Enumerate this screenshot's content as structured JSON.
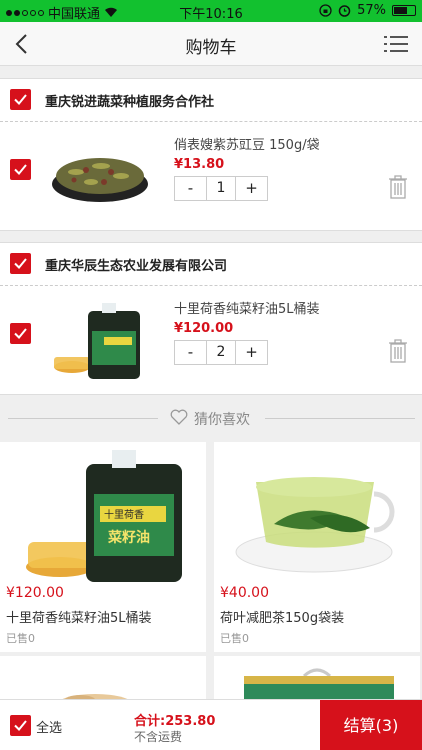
{
  "status_bar": {
    "carrier": "中国联通",
    "time": "下午10:16",
    "battery": "57%",
    "battery_level": 0.57
  },
  "nav": {
    "title": "购物车",
    "back_icon": "chevron-left-icon",
    "menu_icon": "list-menu-icon"
  },
  "shops": [
    {
      "name": "重庆锐进蔬菜种植服务合作社",
      "item": {
        "title": "俏表嫂紫苏豇豆 150g/袋",
        "price": "¥13.80",
        "qty": "1"
      }
    },
    {
      "name": "重庆华辰生态农业发展有限公司",
      "item": {
        "title": "十里荷香纯菜籽油5L桶装",
        "price": "¥120.00",
        "qty": "2"
      }
    }
  ],
  "stepper": {
    "minus": "-",
    "plus": "+"
  },
  "guess": {
    "label": "猜你喜欢"
  },
  "products": [
    {
      "price": "¥120.00",
      "name": "十里荷香纯菜籽油5L桶装",
      "sold": "已售0"
    },
    {
      "price": "¥40.00",
      "name": "荷叶减肥茶150g袋装",
      "sold": "已售0"
    }
  ],
  "oil_label": {
    "brand": "十里荷香",
    "text": "菜籽油"
  },
  "bottom": {
    "select_all": "全选",
    "total": "合计:253.80",
    "shipping": "不含运费",
    "checkout": "结算(3)"
  },
  "colors": {
    "accent": "#d6111b",
    "status_bar": "#12c12f"
  }
}
